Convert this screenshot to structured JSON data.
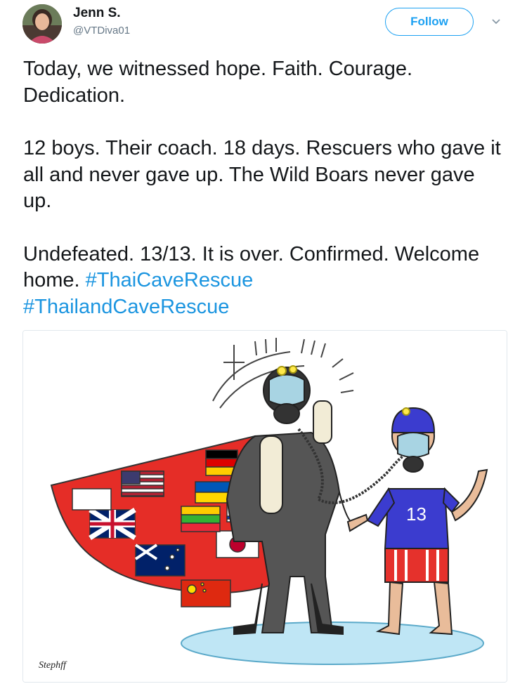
{
  "user": {
    "name": "Jenn S.",
    "handle": "@VTDiva01",
    "avatar_icon": "profile-photo"
  },
  "actions": {
    "follow_label": "Follow",
    "menu_icon": "chevron-down-icon"
  },
  "tweet": {
    "p1": "Today, we witnessed hope. Faith. Courage. Dedication.",
    "p2": "12 boys. Their coach. 18 days. Rescuers who gave it all and never gave up. The Wild Boars never gave up.",
    "p3_text": "Undefeated. 13/13. It is over. Confirmed. Welcome home.",
    "hashtag1": "#ThaiCaveRescue",
    "hashtag2": "#ThailandCaveRescue"
  },
  "media": {
    "boy_jersey_number": "13",
    "signature": "Stephff",
    "flag_icons": [
      "usa-flag-icon",
      "uk-flag-icon",
      "australia-flag-icon",
      "china-flag-icon",
      "japan-flag-icon",
      "israel-flag-icon",
      "germany-flag-icon",
      "ukraine-flag-icon",
      "myanmar-flag-icon"
    ]
  },
  "colors": {
    "accent": "#1da1f2",
    "hashtag": "#1b95e0",
    "handle": "#657786"
  }
}
